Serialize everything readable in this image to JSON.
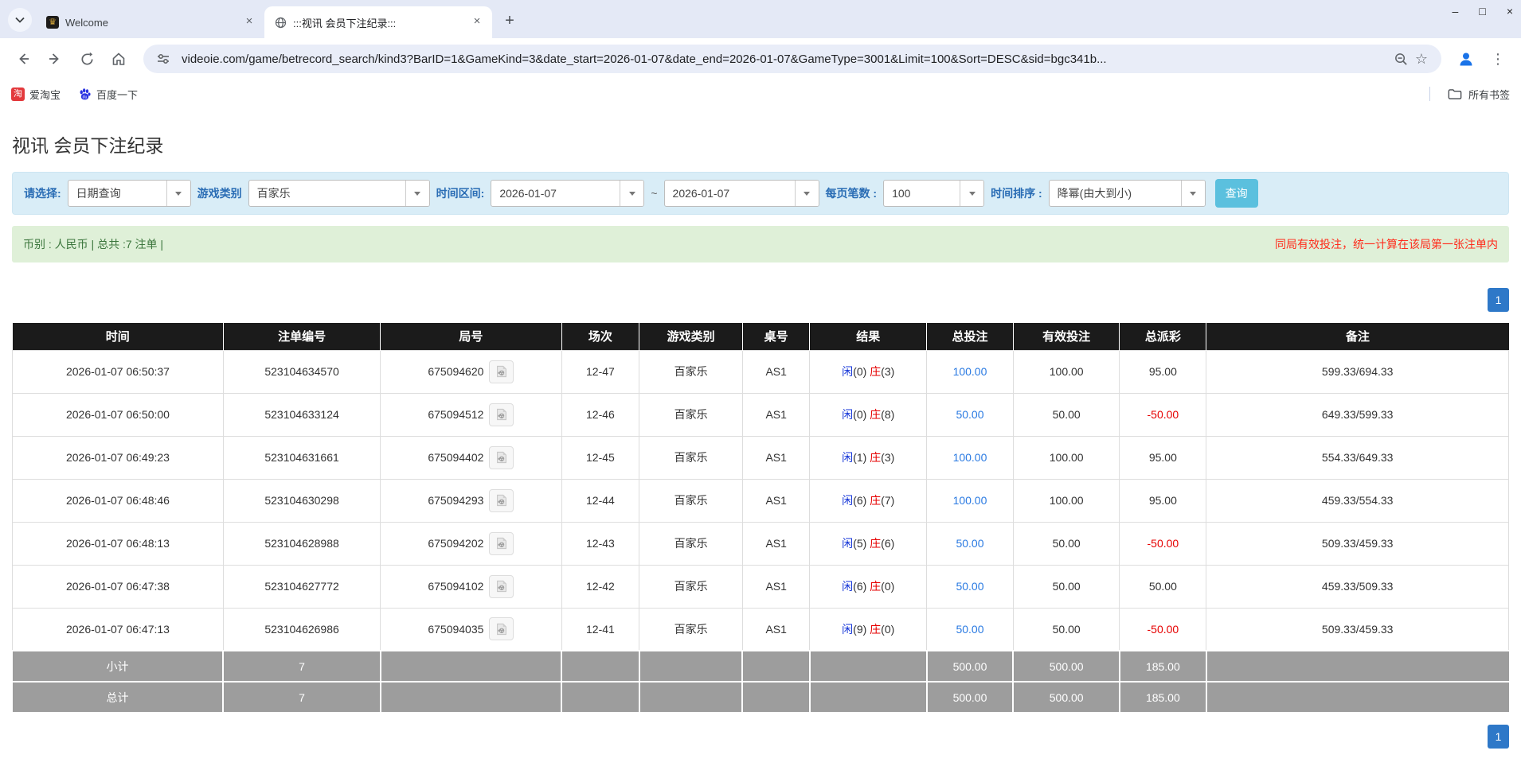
{
  "browser": {
    "tabs": [
      {
        "title": "Welcome"
      },
      {
        "title": ":::视讯 会员下注纪录:::"
      }
    ],
    "url": "videoie.com/game/betrecord_search/kind3?BarID=1&GameKind=3&date_start=2026-01-07&date_end=2026-01-07&GameType=3001&Limit=100&Sort=DESC&sid=bgc341b...",
    "bookmarks": [
      {
        "label": "爱淘宝",
        "icon_text": "淘"
      },
      {
        "label": "百度一下"
      }
    ],
    "all_bookmarks_label": "所有书签",
    "glyphs": {
      "close": "×",
      "new_tab": "+",
      "menu": "⋮",
      "minimize": "–",
      "maximize": "□",
      "star": "☆",
      "welcome_favicon": "♛"
    }
  },
  "colors": {
    "accent_blue": "#2e78c8",
    "link_blue": "#2a7ae2",
    "player_blue": "#1536d8",
    "banker_red": "#e60000",
    "search_button": "#5bc0de",
    "header_black": "#1b1b1b",
    "footer_grey": "#9d9d9d",
    "filter_bg": "#d9edf7",
    "summary_bg": "#dff0d8"
  },
  "page": {
    "title": "视讯 会员下注纪录",
    "filters": {
      "select_label": "请选择:",
      "select_value": "日期查询",
      "game_label": "游戏类别",
      "game_value": "百家乐",
      "range_label": "时间区间:",
      "date_start": "2026-01-07",
      "range_separator": "~",
      "date_end": "2026-01-07",
      "page_size_label": "每页笔数 :",
      "page_size_value": "100",
      "sort_label": "时间排序 :",
      "sort_value": "降幂(由大到小)",
      "search_label": "查询"
    },
    "summary": {
      "left": "币别 : 人民币 | 总共 :7 注单 |",
      "right": "同局有效投注，统一计算在该局第一张注单内"
    },
    "pagination": {
      "page": "1"
    },
    "table": {
      "headers": [
        "时间",
        "注单编号",
        "局号",
        "场次",
        "游戏类别",
        "桌号",
        "结果",
        "总投注",
        "有效投注",
        "总派彩",
        "备注"
      ],
      "rows": [
        {
          "time": "2026-01-07 06:50:37",
          "bet_no": "523104634570",
          "round_no": "675094620",
          "session": "12-47",
          "game_type": "百家乐",
          "table_no": "AS1",
          "result_xian": "闲(0)",
          "result_zhuang": "庄(3)",
          "total_bet": "100.00",
          "valid_bet": "100.00",
          "payout": "95.00",
          "remark": "599.33/694.33"
        },
        {
          "time": "2026-01-07 06:50:00",
          "bet_no": "523104633124",
          "round_no": "675094512",
          "session": "12-46",
          "game_type": "百家乐",
          "table_no": "AS1",
          "result_xian": "闲(0)",
          "result_zhuang": "庄(8)",
          "total_bet": "50.00",
          "valid_bet": "50.00",
          "payout": "-50.00",
          "remark": "649.33/599.33"
        },
        {
          "time": "2026-01-07 06:49:23",
          "bet_no": "523104631661",
          "round_no": "675094402",
          "session": "12-45",
          "game_type": "百家乐",
          "table_no": "AS1",
          "result_xian": "闲(1)",
          "result_zhuang": "庄(3)",
          "total_bet": "100.00",
          "valid_bet": "100.00",
          "payout": "95.00",
          "remark": "554.33/649.33"
        },
        {
          "time": "2026-01-07 06:48:46",
          "bet_no": "523104630298",
          "round_no": "675094293",
          "session": "12-44",
          "game_type": "百家乐",
          "table_no": "AS1",
          "result_xian": "闲(6)",
          "result_zhuang": "庄(7)",
          "total_bet": "100.00",
          "valid_bet": "100.00",
          "payout": "95.00",
          "remark": "459.33/554.33"
        },
        {
          "time": "2026-01-07 06:48:13",
          "bet_no": "523104628988",
          "round_no": "675094202",
          "session": "12-43",
          "game_type": "百家乐",
          "table_no": "AS1",
          "result_xian": "闲(5)",
          "result_zhuang": "庄(6)",
          "total_bet": "50.00",
          "valid_bet": "50.00",
          "payout": "-50.00",
          "remark": "509.33/459.33"
        },
        {
          "time": "2026-01-07 06:47:38",
          "bet_no": "523104627772",
          "round_no": "675094102",
          "session": "12-42",
          "game_type": "百家乐",
          "table_no": "AS1",
          "result_xian": "闲(6)",
          "result_zhuang": "庄(0)",
          "total_bet": "50.00",
          "valid_bet": "50.00",
          "payout": "50.00",
          "remark": "459.33/509.33"
        },
        {
          "time": "2026-01-07 06:47:13",
          "bet_no": "523104626986",
          "round_no": "675094035",
          "session": "12-41",
          "game_type": "百家乐",
          "table_no": "AS1",
          "result_xian": "闲(9)",
          "result_zhuang": "庄(0)",
          "total_bet": "50.00",
          "valid_bet": "50.00",
          "payout": "-50.00",
          "remark": "509.33/459.33"
        }
      ],
      "footer": [
        {
          "label": "小计",
          "count": "7",
          "total_bet": "500.00",
          "valid_bet": "500.00",
          "payout": "185.00"
        },
        {
          "label": "总计",
          "count": "7",
          "total_bet": "500.00",
          "valid_bet": "500.00",
          "payout": "185.00"
        }
      ]
    }
  }
}
